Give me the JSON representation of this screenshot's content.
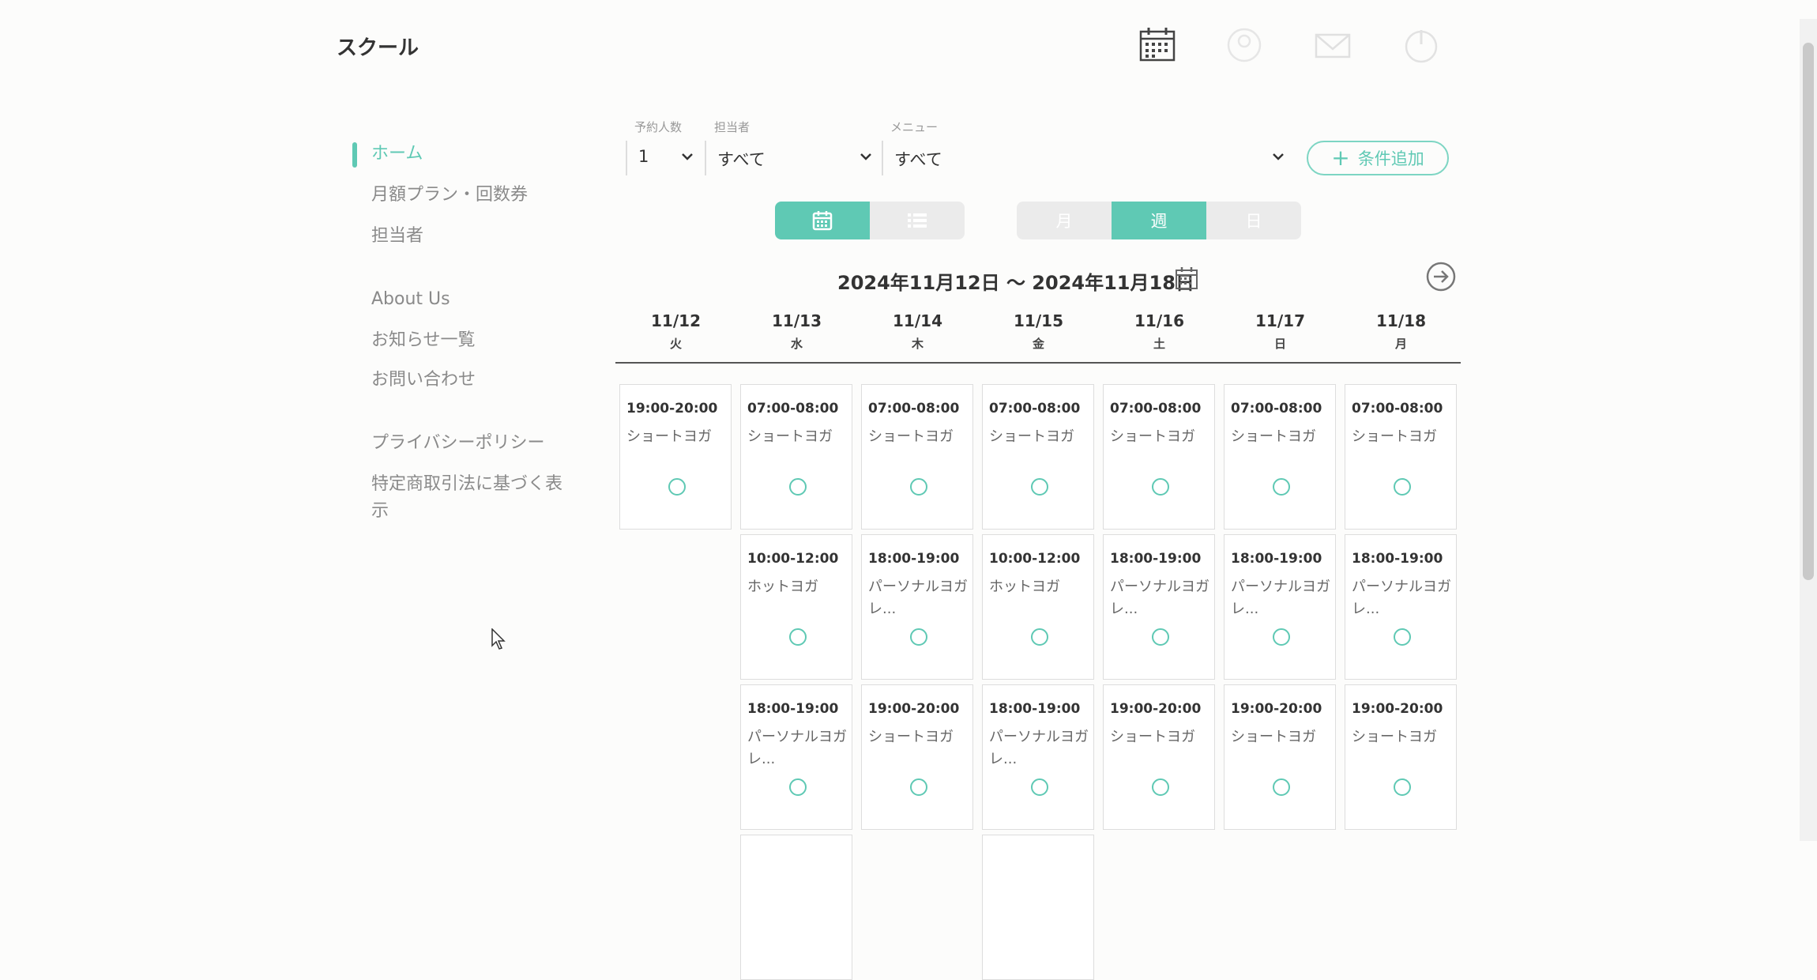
{
  "header": {
    "brand": "スクール",
    "icons": [
      "calendar-icon",
      "user-icon",
      "mail-icon",
      "logout-icon"
    ]
  },
  "sidebar": {
    "items": [
      {
        "label": "ホーム",
        "active": true
      },
      {
        "label": "月額プラン・回数券"
      },
      {
        "label": "担当者"
      },
      {
        "label": "About Us"
      },
      {
        "label": "お知らせ一覧"
      },
      {
        "label": "お問い合わせ"
      },
      {
        "label": "プライバシーポリシー"
      },
      {
        "label": "特定商取引法に基づく表示"
      }
    ]
  },
  "filters": {
    "people_label": "予約人数",
    "people_value": "1",
    "staff_label": "担当者",
    "staff_value": "すべて",
    "menu_label": "メニュー",
    "menu_value": "すべて",
    "add_label": "条件追加"
  },
  "view_toggle": {
    "options": [
      "calendar-icon",
      "list-icon"
    ],
    "selected": "calendar"
  },
  "period_toggle": {
    "options": [
      "月",
      "週",
      "日"
    ],
    "selected": "週"
  },
  "range": {
    "label": "2024年11月12日 〜 2024年11月18日"
  },
  "days": [
    {
      "date": "11/12",
      "weekday": "火"
    },
    {
      "date": "11/13",
      "weekday": "水"
    },
    {
      "date": "11/14",
      "weekday": "木"
    },
    {
      "date": "11/15",
      "weekday": "金"
    },
    {
      "date": "11/16",
      "weekday": "土"
    },
    {
      "date": "11/17",
      "weekday": "日"
    },
    {
      "date": "11/18",
      "weekday": "月"
    }
  ],
  "schedule": [
    [
      {
        "time": "19:00-20:00",
        "name": "ショートヨガ"
      }
    ],
    [
      {
        "time": "07:00-08:00",
        "name": "ショートヨガ"
      },
      {
        "time": "10:00-12:00",
        "name": "ホットヨガ"
      },
      {
        "time": "18:00-19:00",
        "name": "パーソナルヨガレ..."
      },
      {
        "time": "",
        "name": ""
      }
    ],
    [
      {
        "time": "07:00-08:00",
        "name": "ショートヨガ"
      },
      {
        "time": "18:00-19:00",
        "name": "パーソナルヨガレ..."
      },
      {
        "time": "19:00-20:00",
        "name": "ショートヨガ"
      }
    ],
    [
      {
        "time": "07:00-08:00",
        "name": "ショートヨガ"
      },
      {
        "time": "10:00-12:00",
        "name": "ホットヨガ"
      },
      {
        "time": "18:00-19:00",
        "name": "パーソナルヨガレ..."
      },
      {
        "time": "",
        "name": ""
      }
    ],
    [
      {
        "time": "07:00-08:00",
        "name": "ショートヨガ"
      },
      {
        "time": "18:00-19:00",
        "name": "パーソナルヨガレ..."
      },
      {
        "time": "19:00-20:00",
        "name": "ショートヨガ"
      }
    ],
    [
      {
        "time": "07:00-08:00",
        "name": "ショートヨガ"
      },
      {
        "time": "18:00-19:00",
        "name": "パーソナルヨガレ..."
      },
      {
        "time": "19:00-20:00",
        "name": "ショートヨガ"
      }
    ],
    [
      {
        "time": "07:00-08:00",
        "name": "ショートヨガ"
      },
      {
        "time": "18:00-19:00",
        "name": "パーソナルヨガレ..."
      },
      {
        "time": "19:00-20:00",
        "name": "ショートヨガ"
      }
    ]
  ],
  "colors": {
    "accent": "#5fc9b4",
    "toggle_off": "#ebebeb"
  }
}
